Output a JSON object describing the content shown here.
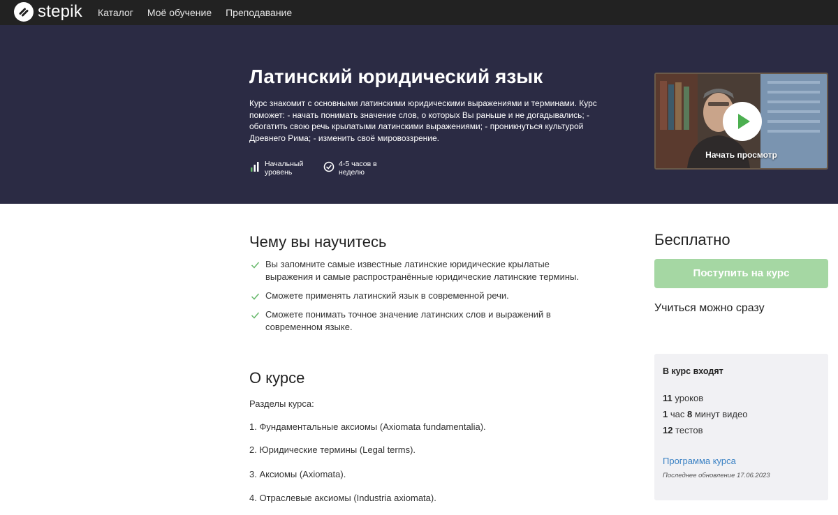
{
  "nav": {
    "brand": "stepik",
    "links": [
      "Каталог",
      "Моё обучение",
      "Преподавание"
    ]
  },
  "hero": {
    "title": "Латинский юридический язык",
    "description": "Курс знакомит с основными латинскими юридическими выражениями и терминами. Курс поможет: - начать понимать значение слов, о которых Вы раньше и не догадывались; - обогатить свою речь крылатыми латинскими выражениями; - проникнуться культурой Древнего Рима; - изменить своё мировоззрение.",
    "level": "Начальный уровень",
    "time": "4-5 часов в неделю",
    "video_label": "Начать просмотр"
  },
  "learn": {
    "title": "Чему вы научитесь",
    "items": [
      "Вы запомните самые известные латинские юридические крылатые выражения и самые распространённые юридические латинские термины.",
      "Сможете применять латинский язык в современной речи.",
      "Сможете понимать точное значение латинских слов и выражений в современном языке."
    ]
  },
  "about": {
    "title": "О курсе",
    "lines": [
      "Разделы курса:",
      "1. Фундаментальные аксиомы (Axiomata fundamentalia).",
      "2. Юридические термины (Legal terms).",
      "3. Аксиомы (Axiomata).",
      "4. Отраслевые аксиомы (Industria axiomata)."
    ]
  },
  "sidebar": {
    "price": "Бесплатно",
    "enroll_label": "Поступить на курс",
    "start_now": "Учиться можно сразу",
    "includes_title": "В курс входят",
    "lessons_num": "11",
    "lessons_text": " уроков",
    "video_hours_num": "1",
    "video_hours_text": " час ",
    "video_minutes_num": "8",
    "video_minutes_text": " минут видео",
    "tests_num": "12",
    "tests_text": " тестов",
    "program_link": "Программа курса",
    "updated": "Последнее обновление 17.06.2023"
  },
  "colors": {
    "nav_bg": "#222222",
    "hero_bg": "#2b2b44",
    "accent_green": "#a5d7a3",
    "check_green": "#66b86a",
    "link_blue": "#3b82c4"
  }
}
